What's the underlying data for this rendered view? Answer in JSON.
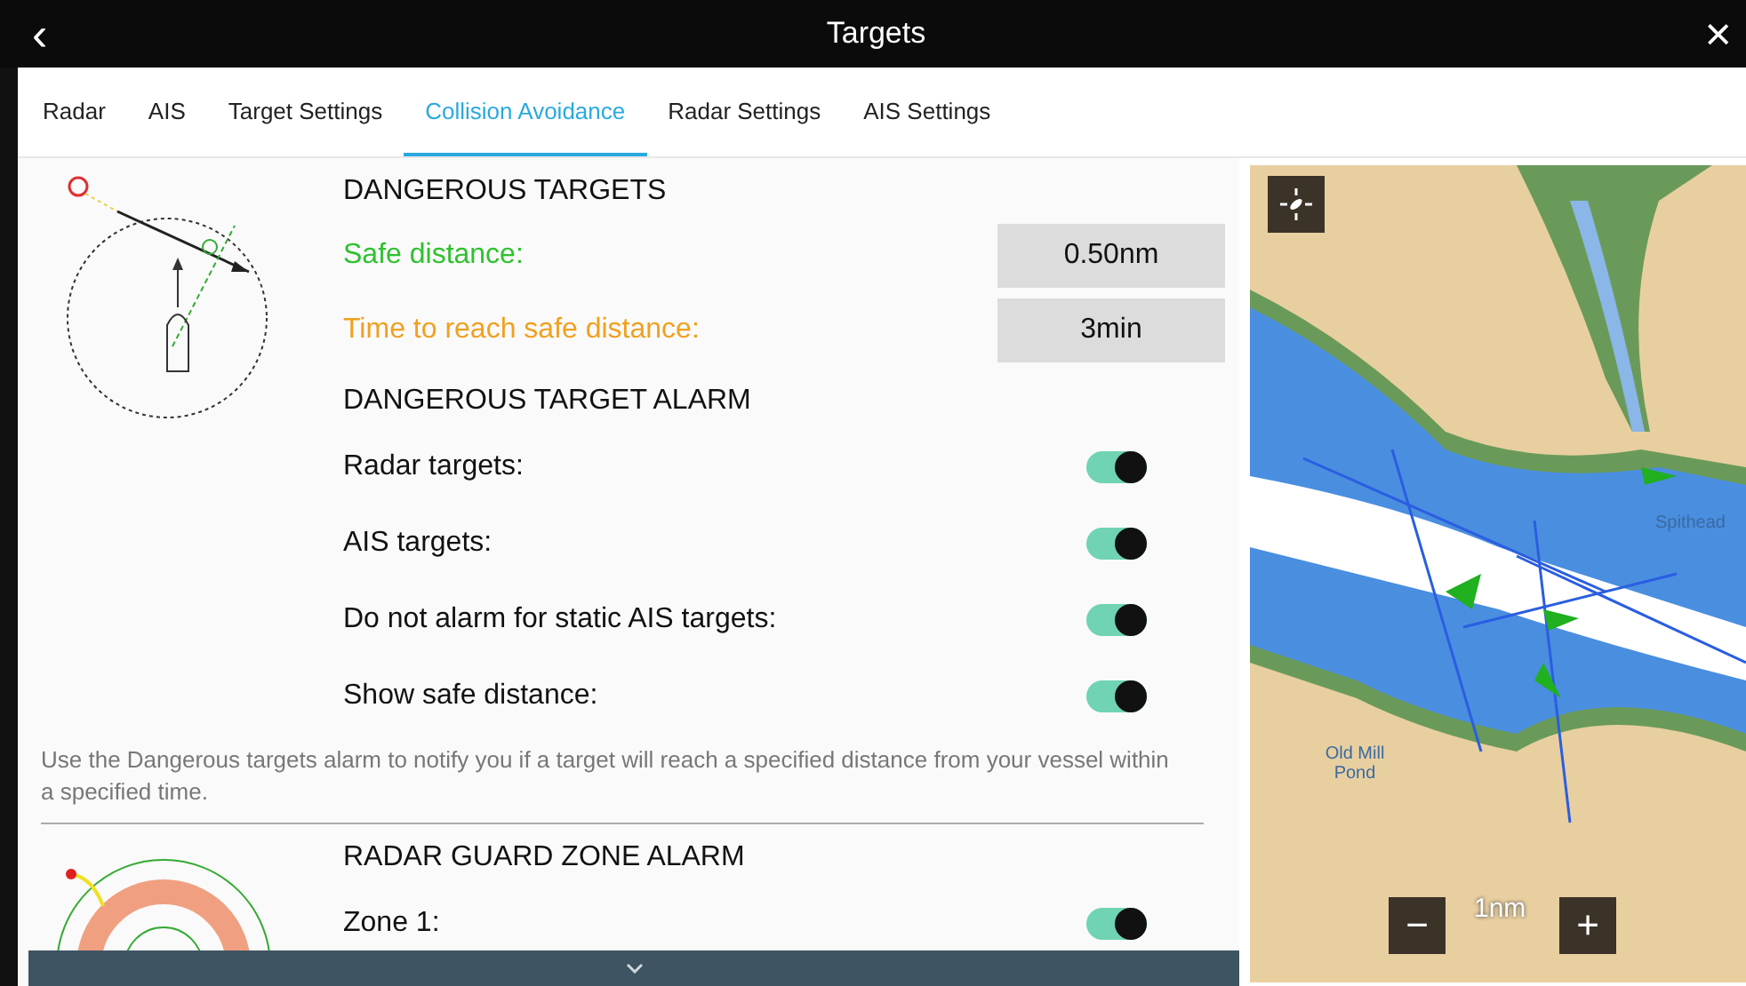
{
  "window": {
    "title": "Targets",
    "back_icon": "‹",
    "close_icon": "×"
  },
  "tabs": [
    {
      "label": "Radar",
      "selected": false
    },
    {
      "label": "AIS",
      "selected": false
    },
    {
      "label": "Target Settings",
      "selected": false
    },
    {
      "label": "Collision Avoidance",
      "selected": true
    },
    {
      "label": "Radar Settings",
      "selected": false
    },
    {
      "label": "AIS Settings",
      "selected": false
    }
  ],
  "dangerous_targets": {
    "heading": "DANGEROUS TARGETS",
    "fields": [
      {
        "label": "Safe distance:",
        "value": "0.50nm",
        "color": "#2ec22e"
      },
      {
        "label": "Time to reach safe distance:",
        "value": "3min",
        "color": "#f0a020"
      }
    ],
    "alarm_heading": "DANGEROUS TARGET ALARM",
    "toggles": [
      {
        "label": "Radar targets:",
        "on": true
      },
      {
        "label": "AIS targets:",
        "on": true
      },
      {
        "label": "Do not alarm for static AIS targets:",
        "on": true
      },
      {
        "label": "Show safe distance:",
        "on": true
      }
    ],
    "description": "Use the Dangerous targets alarm to notify you if a target will reach a specified distance from your vessel within a specified time."
  },
  "guard_zone": {
    "heading": "RADAR GUARD ZONE ALARM",
    "toggles": [
      {
        "label": "Zone 1:",
        "on": true
      }
    ]
  },
  "map": {
    "labels": [
      "Spithead",
      "Old Mill Pond"
    ],
    "scale": "1nm",
    "zoom_out": "−",
    "zoom_in": "+"
  }
}
